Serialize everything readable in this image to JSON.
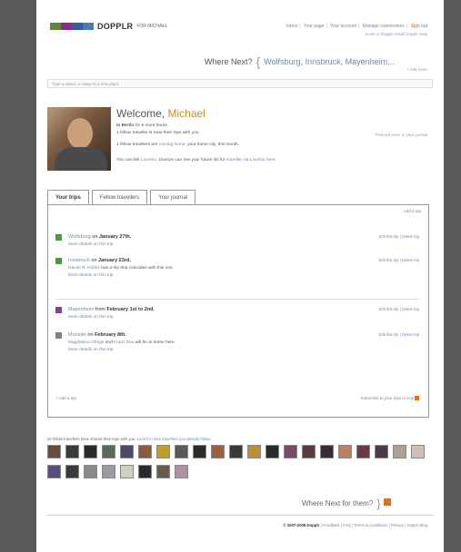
{
  "header": {
    "logo_text": "DOPPLR",
    "logo_suffix": "FOR MICHAEL",
    "logo_colors": [
      "#5a8a3a",
      "#8a2a8a",
      "#3a5aa0",
      "#4a7ab0"
    ],
    "links": [
      "Inbox",
      "Your page",
      "Your account",
      "Manage connections"
    ],
    "signout": "Sign out",
    "subline": "Invite to Dopplr  Install Dopplr  Help"
  },
  "where_next": {
    "label": "Where Next?",
    "places": "Wolfsburg, Innsbruck, Mayenheim...",
    "add_more": "+ Add more"
  },
  "status_bar": {
    "placeholder": "Type a status or away to a new place"
  },
  "welcome": {
    "greeting": "Welcome,",
    "name": "Michael",
    "location": "in Berlin",
    "location_suffix": "for 5 more hours.",
    "line1": "1 fellow traveller is near their trips with you.",
    "line2_a": "1 fellow travellers are",
    "line2_link": "coming home",
    "line2_b": ", your home city, this month.",
    "line3_a": "You can link",
    "line3_link1": "Lovoloo",
    "line3_b": ". Doorize can see your future list for",
    "line3_link2": "traveller via Lovoloo here",
    "findout": "Find out more in your journal"
  },
  "tabs": [
    {
      "label": "Your trips",
      "active": true
    },
    {
      "label": "Fellow travellers",
      "active": false
    },
    {
      "label": "Your journal",
      "active": false
    }
  ],
  "panel": {
    "add_trip": "Add a trip",
    "add_link": "+ Add a trip",
    "feed_label": "Subscribe to your trips in iCal"
  },
  "trips": [
    {
      "color": "#4a9a3a",
      "city": "Wolfsburg",
      "mid": " on ",
      "date": "January 27th.",
      "sub_link": "More details on this trip",
      "sub_extra": "",
      "actions": "Edit this trip | Delete trip"
    },
    {
      "color": "#4a9a3a",
      "city": "Innsbruck",
      "mid": " on ",
      "date": "January 23rd.",
      "sub_person": "Daniel R. Hobbs",
      "sub_plain": " has a trip that coincides with this one.",
      "sub_link": "More details on this trip",
      "actions": "Edit this trip | Delete trip"
    },
    {
      "color": "#8a3a9a",
      "city": "Mayenheim",
      "mid": " from ",
      "date": "February 1st to 2nd.",
      "sub_link": "More details on this trip",
      "actions": "Edit this trip | Delete trip"
    },
    {
      "color": "#7a8090",
      "city": "Münster",
      "mid": " on ",
      "date": "February 8th.",
      "sub_person": "Magdalena Ohrige",
      "sub_plain": " and ",
      "sub_person2": "Franz Sue",
      "sub_plain2": " will be at home here.",
      "sub_link": "More details on this trip",
      "actions": "Edit this trip | Delete trip"
    }
  ],
  "friends": {
    "caption": "32 fellow travellers have shared their trips with you.",
    "caption_link": "Look for more travellers you already follow",
    "thumb_colors": [
      "#6a4a3a",
      "#3a3a3a",
      "#2a2a2a",
      "#5a6a5a",
      "#4a4a6a",
      "#8a5a3a",
      "#c0a020",
      "#5a5a5a",
      "#2a2a2a",
      "#a06040",
      "#3a3a3a",
      "#c09030",
      "#2a2a2a",
      "#7a4a6a",
      "#5a3a3a",
      "#3a2a3a",
      "#c08060",
      "#6a3a4a",
      "#4a3a4a",
      "#b0a090",
      "#d0c0b0",
      "#5a4a8a",
      "#3a3a3a",
      "#8a8a8a",
      "#9a9aa0",
      "#d0d0c0",
      "#2a2a2a",
      "#6a5a4a",
      "#b090a0"
    ]
  },
  "footer": {
    "where_next": "Where Next for them?",
    "copyright": "© 2007-2008 Dopplr",
    "links": "| Feedback | FAQ | Terms & Conditions | Privacy | Dopplr Blog"
  }
}
